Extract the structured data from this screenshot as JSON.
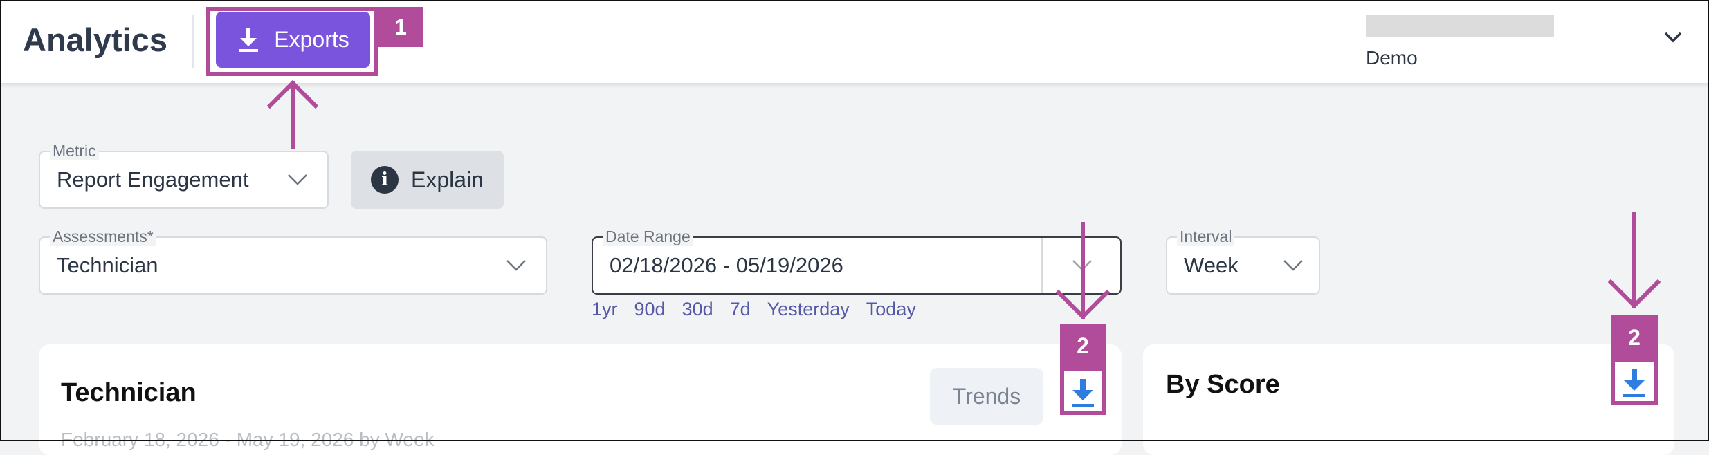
{
  "header": {
    "title": "Analytics",
    "exports_label": "Exports",
    "user_name": "Demo"
  },
  "filters": {
    "metric": {
      "label": "Metric",
      "value": "Report Engagement"
    },
    "explain_label": "Explain",
    "assessments": {
      "label": "Assessments*",
      "value": "Technician"
    },
    "date_range": {
      "label": "Date Range",
      "value": "02/18/2026 - 05/19/2026"
    },
    "quick_ranges": [
      "1yr",
      "90d",
      "30d",
      "7d",
      "Yesterday",
      "Today"
    ],
    "interval": {
      "label": "Interval",
      "value": "Week"
    }
  },
  "cards": {
    "technician": {
      "title": "Technician",
      "trends_label": "Trends",
      "subtitle": "February 18, 2026 - May 19, 2026 by Week"
    },
    "by_score": {
      "title": "By Score"
    }
  },
  "annotations": {
    "exports_num": "1",
    "download_num_a": "2",
    "download_num_b": "2"
  },
  "colors": {
    "accent": "#7b54dd",
    "annotation": "#b04c9a",
    "download_icon": "#2f7de1",
    "link": "#5558a6"
  }
}
